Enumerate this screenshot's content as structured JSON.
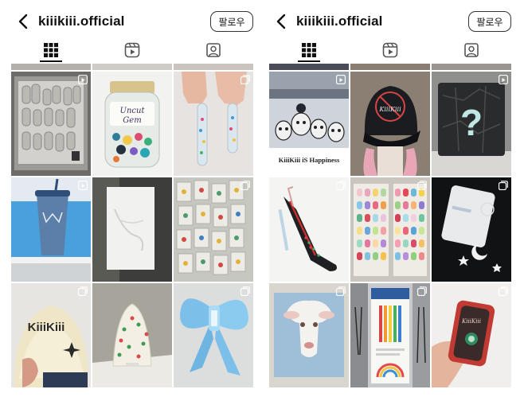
{
  "left_panel": {
    "username": "kiiikiii.official",
    "follow_label": "팔로우",
    "tabs": [
      {
        "icon": "grid-icon",
        "active": true
      },
      {
        "icon": "reels-icon",
        "active": false
      },
      {
        "icon": "tagged-icon",
        "active": false
      }
    ],
    "tiles": [
      {
        "subject": "KiiiKiii letters in bottle caps",
        "badge": "reel"
      },
      {
        "label_line1": "Uncut",
        "label_line2": "Gem",
        "badge": "none"
      },
      {
        "subject": "glitter nails",
        "badge": "carousel"
      },
      {
        "subject": "sparkly tumbler by pool",
        "badge": "reel"
      },
      {
        "subject": "white card",
        "badge": "none"
      },
      {
        "subject": "packaged pins",
        "badge": "carousel"
      },
      {
        "caption": "KiiiKiii",
        "badge": "carousel"
      },
      {
        "subject": "cake",
        "badge": "none"
      },
      {
        "subject": "blue bow",
        "badge": "carousel"
      }
    ]
  },
  "right_panel": {
    "username": "kiiikiii.official",
    "follow_label": "팔로우",
    "tabs": [
      {
        "icon": "grid-icon",
        "active": true
      },
      {
        "icon": "reels-icon",
        "active": false
      },
      {
        "icon": "tagged-icon",
        "active": false
      }
    ],
    "tiles": [
      {
        "caption": "KiiiKiii iS Happiness",
        "badge": "reel"
      },
      {
        "cap_text": "KiiiKiii",
        "badge": "none"
      },
      {
        "symbol": "?",
        "badge": "reel"
      },
      {
        "subject": "clear heel",
        "badge": "carousel"
      },
      {
        "subject": "nail color swatches",
        "badge": "carousel"
      },
      {
        "subject": "phone charm",
        "badge": "carousel"
      },
      {
        "subject": "lamb illustration",
        "badge": "carousel"
      },
      {
        "subject": "colored pencils box",
        "badge": "carousel"
      },
      {
        "tag_text": "KiiiKiii",
        "badge": "carousel"
      }
    ]
  },
  "colors": {
    "text": "#111111",
    "accent_border": "#333333"
  }
}
